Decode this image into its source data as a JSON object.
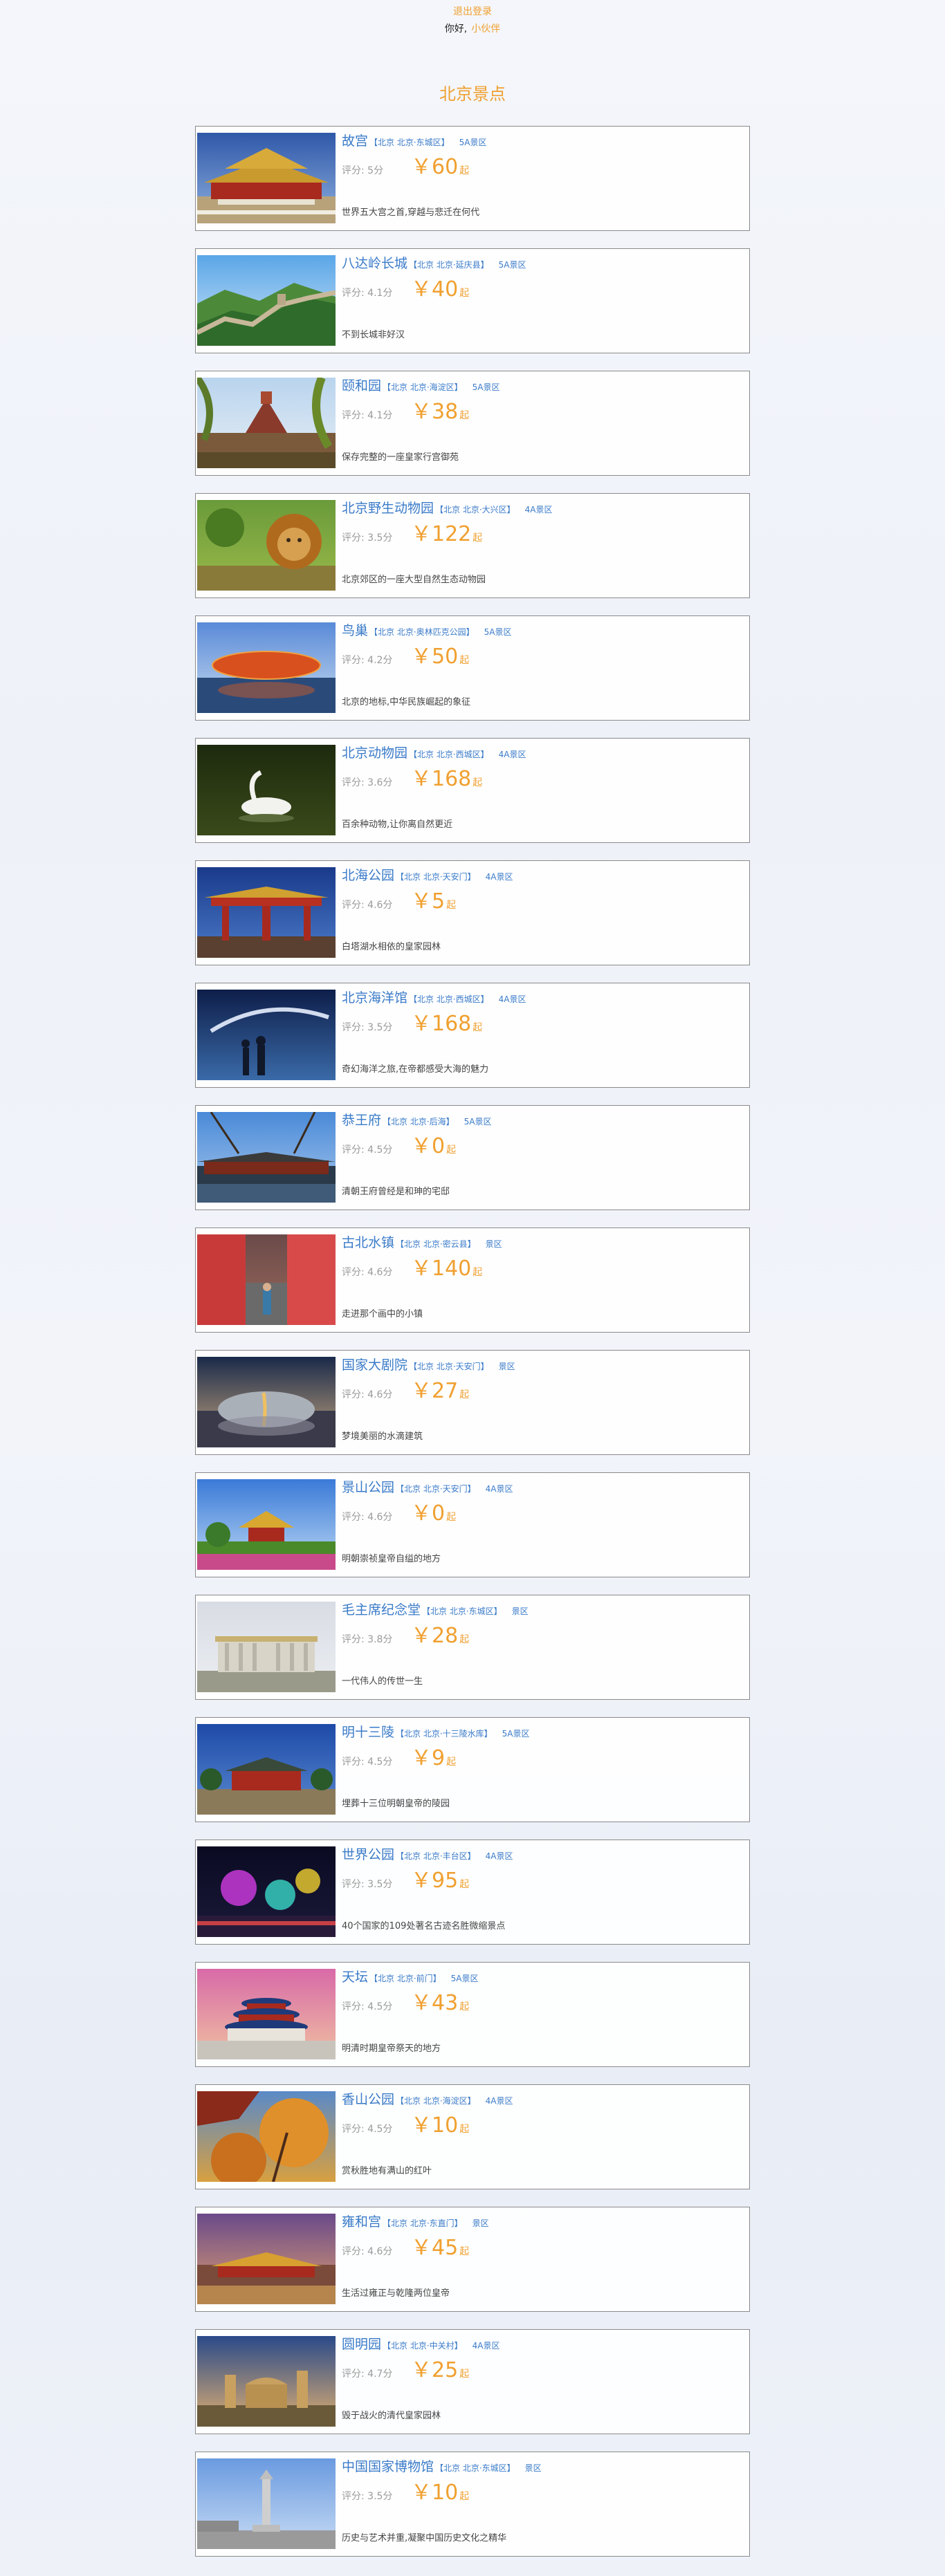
{
  "header": {
    "logout": "退出登录",
    "greeting": "你好,",
    "username": "小伙伴"
  },
  "page_title": "北京景点",
  "colors": {
    "accent": "#f0a030",
    "link": "#3a7bc8"
  },
  "attractions": [
    {
      "name": "故宫",
      "location": "【北京 北京·东城区】",
      "grade": "5A景区",
      "score": "评分: 5分",
      "price": "￥60",
      "unit": "起",
      "desc": "世界五大宫之首,穿越与悲迁在何代",
      "scene": "palace"
    },
    {
      "name": "八达岭长城",
      "location": "【北京 北京·延庆县】",
      "grade": "5A景区",
      "score": "评分: 4.1分",
      "price": "￥40",
      "unit": "起",
      "desc": "不到长城非好汉",
      "scene": "wall"
    },
    {
      "name": "颐和园",
      "location": "【北京 北京·海淀区】",
      "grade": "5A景区",
      "score": "评分: 4.1分",
      "price": "￥38",
      "unit": "起",
      "desc": "保存完整的一座皇家行宫御苑",
      "scene": "summer"
    },
    {
      "name": "北京野生动物园",
      "location": "【北京 北京·大兴区】",
      "grade": "4A景区",
      "score": "评分: 3.5分",
      "price": "￥122",
      "unit": "起",
      "desc": "北京郊区的一座大型自然生态动物园",
      "scene": "lion"
    },
    {
      "name": "鸟巢",
      "location": "【北京 北京·奥林匹克公园】",
      "grade": "5A景区",
      "score": "评分: 4.2分",
      "price": "￥50",
      "unit": "起",
      "desc": "北京的地标,中华民族崛起的象征",
      "scene": "nest"
    },
    {
      "name": "北京动物园",
      "location": "【北京 北京·西城区】",
      "grade": "4A景区",
      "score": "评分: 3.6分",
      "price": "￥168",
      "unit": "起",
      "desc": "百余种动物,让你离自然更近",
      "scene": "swan"
    },
    {
      "name": "北海公园",
      "location": "【北京 北京·天安门】",
      "grade": "4A景区",
      "score": "评分: 4.6分",
      "price": "￥5",
      "unit": "起",
      "desc": "白塔湖水相依的皇家园林",
      "scene": "gate"
    },
    {
      "name": "北京海洋馆",
      "location": "【北京 北京·西城区】",
      "grade": "4A景区",
      "score": "评分: 3.5分",
      "price": "￥168",
      "unit": "起",
      "desc": "奇幻海洋之旅,在帝都感受大海的魅力",
      "scene": "ocean"
    },
    {
      "name": "恭王府",
      "location": "【北京 北京·后海】",
      "grade": "5A景区",
      "score": "评分: 4.5分",
      "price": "￥0",
      "unit": "起",
      "desc": "清朝王府曾经是和珅的宅邸",
      "scene": "mansion"
    },
    {
      "name": "古北水镇",
      "location": "【北京 北京·密云县】",
      "grade": "景区",
      "score": "评分: 4.6分",
      "price": "￥140",
      "unit": "起",
      "desc": "走进那个画中的小镇",
      "scene": "town"
    },
    {
      "name": "国家大剧院",
      "location": "【北京 北京·天安门】",
      "grade": "景区",
      "score": "评分: 4.6分",
      "price": "￥27",
      "unit": "起",
      "desc": "梦境美丽的水滴建筑",
      "scene": "egg"
    },
    {
      "name": "景山公园",
      "location": "【北京 北京·天安门】",
      "grade": "4A景区",
      "score": "评分: 4.6分",
      "price": "￥0",
      "unit": "起",
      "desc": "明朝崇祯皇帝自缢的地方",
      "scene": "pavilion"
    },
    {
      "name": "毛主席纪念堂",
      "location": "【北京 北京·东城区】",
      "grade": "景区",
      "score": "评分: 3.8分",
      "price": "￥28",
      "unit": "起",
      "desc": "一代伟人的传世一生",
      "scene": "hall"
    },
    {
      "name": "明十三陵",
      "location": "【北京 北京·十三陵水库】",
      "grade": "5A景区",
      "score": "评分: 4.5分",
      "price": "￥9",
      "unit": "起",
      "desc": "埋葬十三位明朝皇帝的陵园",
      "scene": "tomb"
    },
    {
      "name": "世界公园",
      "location": "【北京 北京·丰台区】",
      "grade": "4A景区",
      "score": "评分: 3.5分",
      "price": "￥95",
      "unit": "起",
      "desc": "40个国家的109处著名古迹名胜微缩景点",
      "scene": "lights"
    },
    {
      "name": "天坛",
      "location": "【北京 北京·前门】",
      "grade": "5A景区",
      "score": "评分: 4.5分",
      "price": "￥43",
      "unit": "起",
      "desc": "明清时期皇帝祭天的地方",
      "scene": "temple"
    },
    {
      "name": "香山公园",
      "location": "【北京 北京·海淀区】",
      "grade": "4A景区",
      "score": "评分: 4.5分",
      "price": "￥10",
      "unit": "起",
      "desc": "赏秋胜地有满山的红叶",
      "scene": "autumn"
    },
    {
      "name": "雍和宫",
      "location": "【北京 北京·东直门】",
      "grade": "景区",
      "score": "评分: 4.6分",
      "price": "￥45",
      "unit": "起",
      "desc": "生活过雍正与乾隆两位皇帝",
      "scene": "lama"
    },
    {
      "name": "圆明园",
      "location": "【北京 北京·中关村】",
      "grade": "4A景区",
      "score": "评分: 4.7分",
      "price": "￥25",
      "unit": "起",
      "desc": "毁于战火的清代皇家园林",
      "scene": "ruins"
    },
    {
      "name": "中国国家博物馆",
      "location": "【北京 北京·东城区】",
      "grade": "景区",
      "score": "评分: 3.5分",
      "price": "￥10",
      "unit": "起",
      "desc": "历史与艺术并重,凝聚中国历史文化之精华",
      "scene": "museum"
    }
  ]
}
